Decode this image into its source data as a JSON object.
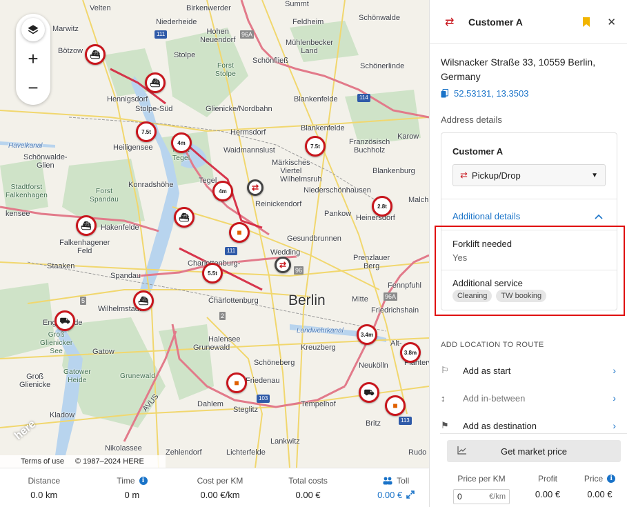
{
  "map": {
    "labels": {
      "velten": "Velten",
      "birkenwerder": "Birkenwerder",
      "summt": "Summt",
      "schonwalde_n": "Schönwalde",
      "marwitz": "Marwitz",
      "niederheide": "Niederheide",
      "hohen_neuendorf": "Hohen\nNeuendorf",
      "feldheim": "Feldheim",
      "muhlenbecker": "Mühlenbecker\nLand",
      "botzow": "Bötzow",
      "stolpe": "Stolpe",
      "schonflies": "Schönfließ",
      "schonerlinde": "Schönerlinde",
      "forst_stolpe": "Forst\nStolpe",
      "hennigsdorf": "Hennigsdorf",
      "stolpe_sud": "Stolpe-Süd",
      "glienicke": "Glienicke/Nordbahn",
      "hermsdorf": "Hermsdorf",
      "blankenfelde": "Blankenfelde",
      "heiligensee": "Heiligensee",
      "havelkanal": "Havelkanal",
      "waidmannslust": "Waidmannslust",
      "franzosisch": "Französisch\nBuchholz",
      "karow": "Karow",
      "schonwalde_gl": "Schönwalde-\nGlien",
      "forst_tegel": "Forst\nTegel",
      "markisches": "Märkisches\nViertel",
      "blankenburg": "Blankenburg",
      "wilhelmsruh": "Wilhelmsruh",
      "konradshohe": "Konradshöhe",
      "tegel": "Tegel",
      "niederschonhausen": "Niederschönhausen",
      "stadtforst": "Stadtforst\nFalkenhagen",
      "forst_spandau": "Forst\nSpandau",
      "reinickendorf": "Reinickendorf",
      "heinersdorf": "Heinersdorf",
      "malchow": "Malch",
      "kensee": "kensee",
      "hakenfelde": "Hakenfelde",
      "pankow": "Pankow",
      "falkenhagener": "Falkenhagener\nFeld",
      "gesundbrunnen": "Gesundbrunnen",
      "prenzlauer": "Prenzlauer\nBerg",
      "wedding": "Wedding",
      "staaken": "Staaken",
      "spandau": "Spandau",
      "charlottenburg_n": "Charlottenburg-\nNord",
      "fennpfuhl": "Fennpfuhl",
      "charlottenburg": "Charlottenburg",
      "mitte": "Mitte",
      "friedrichshain": "Friedrichshain",
      "wilhelmstadt": "Wilhelmstadt",
      "berlin": "Berlin",
      "engelsfelde": "Engelsfelde",
      "gross_glienicker": "Groß\nGlienicker\nSee",
      "landwehrkanal": "Landwehrkanal",
      "halensee": "Halensee",
      "grunewald": "Grunewald",
      "kreuzberg": "Kreuzberg",
      "alt": "Alt-",
      "gatow": "Gatow",
      "schoneberg": "Schöneberg",
      "neukolln": "Neukölln",
      "planterwald": "Planterw",
      "gatower_heide": "Gatower\nHeide",
      "forst_grunewald": "Grunewald",
      "friedenau": "Friedenau",
      "gross_glienicke": "Groß\nGlienicke",
      "tempelhof": "Tempelhof",
      "dahlem": "Dahlem",
      "steglitz": "Steglitz",
      "britz": "Britz",
      "kladow": "Kladow",
      "avus": "AVUS",
      "lankwitz": "Lankwitz",
      "nikolassee": "Nikolassee",
      "zehlendorf": "Zehlendorf",
      "lichterfelde": "Lichterfelde",
      "rudow": "Rudo"
    },
    "shields": [
      "111",
      "96A",
      "114",
      "111",
      "96",
      "5",
      "2",
      "96A",
      "103",
      "113",
      "96A",
      "2"
    ],
    "markers": [
      "7.5t",
      "4m",
      "7.5t",
      "4m",
      "2.8t",
      "5.5t",
      "3.4m",
      "3.8m"
    ],
    "zoom_in": "+",
    "zoom_out": "−",
    "layers_icon": "layers-icon",
    "brand": "here",
    "terms": "Terms of use",
    "copyright": "© 1987–2024 HERE"
  },
  "stats": {
    "distance_label": "Distance",
    "distance_value": "0.0 km",
    "time_label": "Time",
    "time_value": "0 m",
    "cpk_label": "Cost per KM",
    "cpk_value": "0.00 €/km",
    "total_label": "Total costs",
    "total_value": "0.00 €",
    "toll_label": "Toll",
    "toll_value": "0.00 €"
  },
  "panel": {
    "title": "Customer A",
    "address": "Wilsnacker Straße 33, 10559 Berlin, Germany",
    "coords": "52.53131, 13.3503",
    "address_details_label": "Address details",
    "card": {
      "name": "Customer A",
      "type": "Pickup/Drop",
      "additional_details": "Additional details",
      "forklift_label": "Forklift needed",
      "forklift_value": "Yes",
      "service_label": "Additional service",
      "chips": [
        "Cleaning",
        "TW booking"
      ]
    },
    "route_title": "ADD LOCATION TO ROUTE",
    "route_items": [
      "Add as start",
      "Add in-between",
      "Add as destination"
    ],
    "market_button": "Get market price",
    "price_per_km_label": "Price per KM",
    "price_per_km_value": "0",
    "price_per_km_unit": "€/km",
    "profit_label": "Profit",
    "profit_value": "0.00 €",
    "price_label": "Price",
    "price_value": "0.00 €"
  },
  "colors": {
    "accent": "#1a73c8",
    "brand_red": "#c8161d",
    "highlight": "#e01010"
  }
}
